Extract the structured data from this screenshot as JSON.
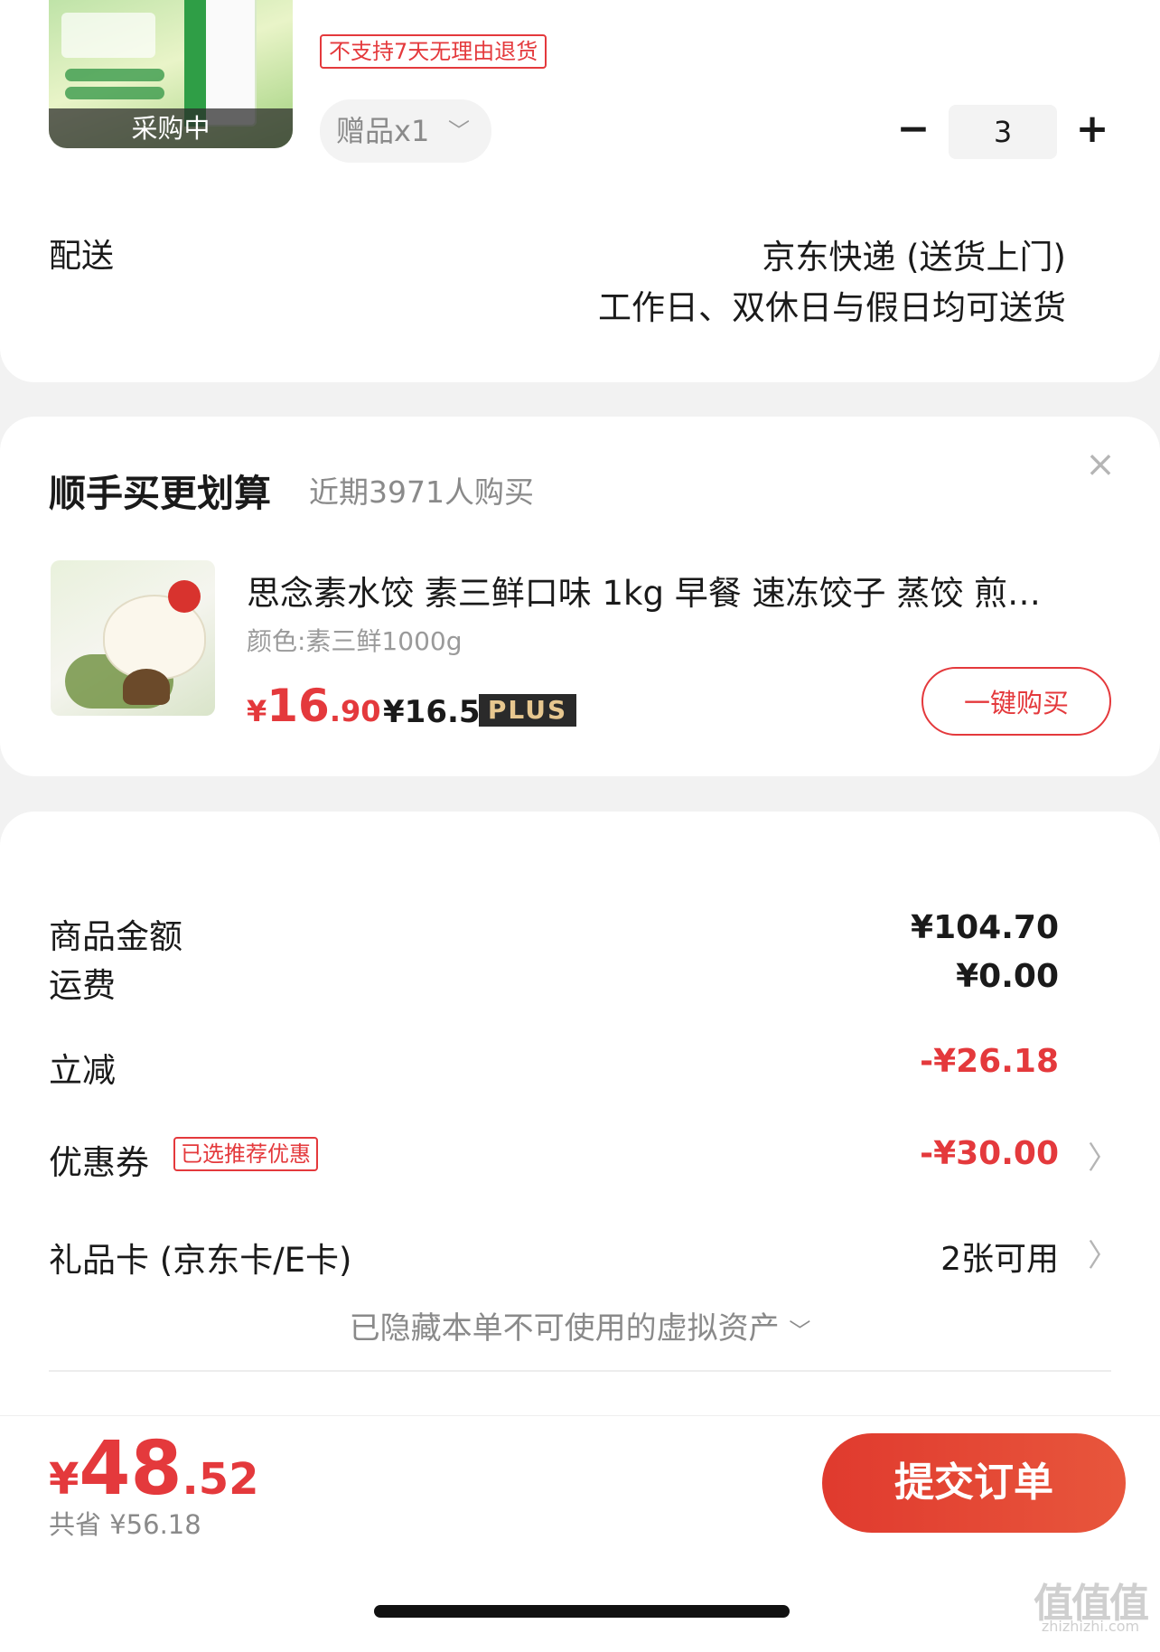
{
  "product": {
    "image_status": "采购中",
    "return_policy": "不支持7天无理由退货",
    "gift_label": "赠品x1",
    "quantity": "3"
  },
  "delivery": {
    "label": "配送",
    "method": "京东快递 (送货上门)",
    "schedule": "工作日、双休日与假日均可送货"
  },
  "recommend": {
    "title": "顺手买更划算",
    "subtitle": "近期3971人购买",
    "item": {
      "name": "思念素水饺 素三鲜口味 1kg 早餐 速冻饺子 蒸饺 煎…",
      "spec": "颜色:素三鲜1000g",
      "price_currency": "¥",
      "price_int": "16",
      "price_dec": ".90",
      "plus_price": "¥16.50",
      "plus_badge": "PLUS",
      "buy_button": "一键购买"
    }
  },
  "summary": {
    "rows": [
      {
        "label": "商品金额",
        "value": "¥104.70"
      },
      {
        "label": "运费",
        "value": "¥0.00"
      },
      {
        "label": "立减",
        "value": "-¥26.18"
      },
      {
        "label": "优惠券",
        "tag": "已选推荐优惠",
        "value": "-¥30.00"
      },
      {
        "label": "礼品卡 (京东卡/E卡)",
        "value": "2张可用"
      }
    ],
    "hidden_assets": "已隐藏本单不可使用的虚拟资产"
  },
  "footer": {
    "price_currency": "¥",
    "price_int": "48",
    "price_dec": ".52",
    "saved": "共省 ¥56.18",
    "submit": "提交订单"
  },
  "watermark": {
    "text": "值值值",
    "site": "zhizhizhi.com"
  },
  "colors": {
    "accent": "#e4393c",
    "background": "#f2f2f2"
  }
}
